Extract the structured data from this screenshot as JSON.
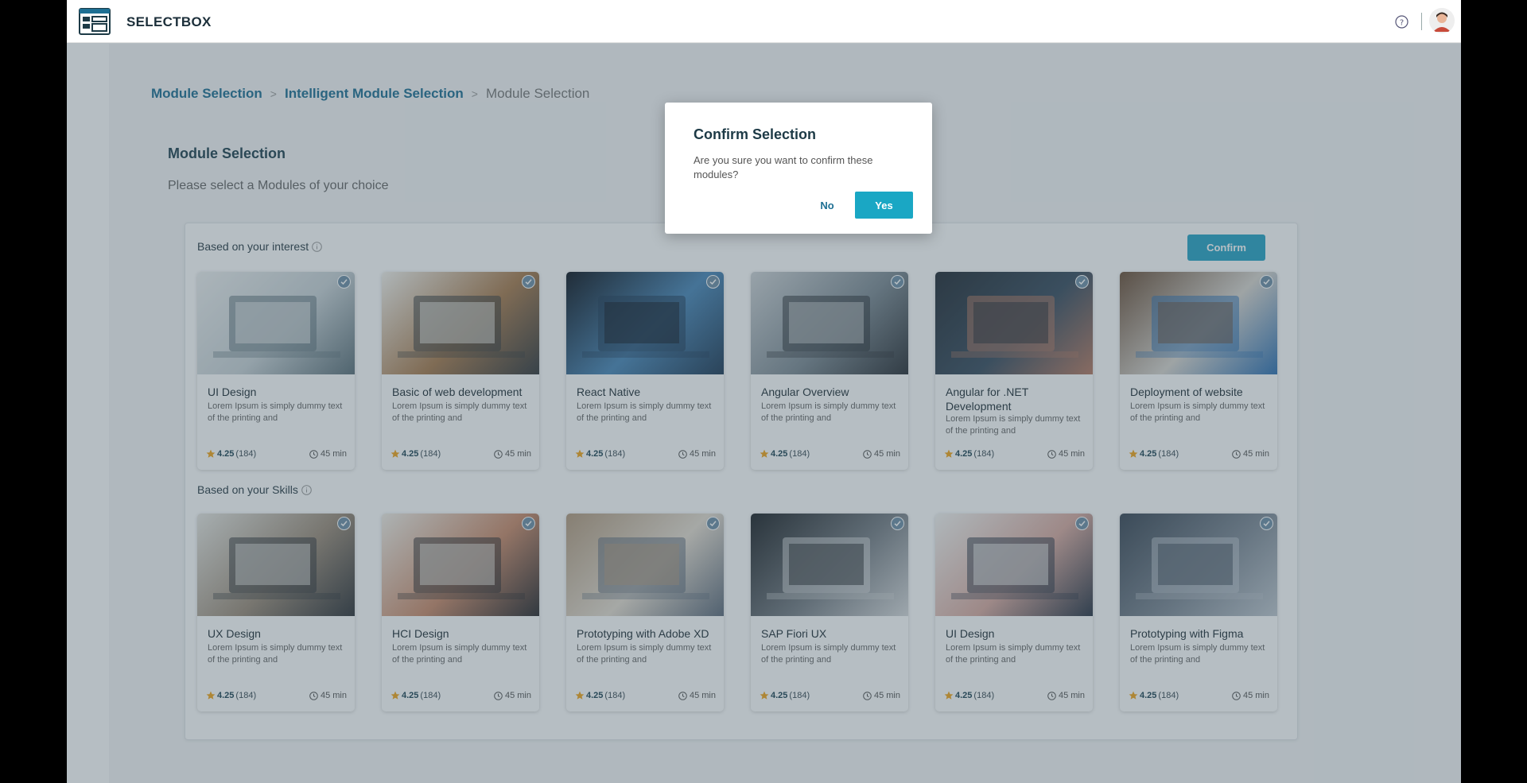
{
  "app": {
    "brand": "SELECTBOX"
  },
  "breadcrumb": [
    "Module Selection",
    "Intelligent Module Selection",
    "Module Selection"
  ],
  "page": {
    "title": "Module Selection",
    "subtitle": "Please select a Modules of your choice"
  },
  "sections": [
    {
      "title": "Based on your interest"
    },
    {
      "title": "Based on your Skills"
    }
  ],
  "confirm_label": "Confirm",
  "cards": [
    {
      "title": "UI Design",
      "desc": "Lorem Ipsum is simply dummy text of the printing and",
      "rating": "4.25",
      "count": "(184)",
      "duration": "45 min"
    },
    {
      "title": "Basic of web development",
      "desc": "Lorem Ipsum is simply dummy text of the printing and",
      "rating": "4.25",
      "count": "(184)",
      "duration": "45 min"
    },
    {
      "title": "React Native",
      "desc": "Lorem Ipsum is simply dummy text of the printing and",
      "rating": "4.25",
      "count": "(184)",
      "duration": "45 min"
    },
    {
      "title": "Angular Overview",
      "desc": "Lorem Ipsum is simply dummy text of the printing and",
      "rating": "4.25",
      "count": "(184)",
      "duration": "45 min"
    },
    {
      "title": "Angular for .NET Development",
      "desc": "Lorem Ipsum is simply dummy text of the printing and",
      "rating": "4.25",
      "count": "(184)",
      "duration": "45 min"
    },
    {
      "title": "Deployment of website",
      "desc": "Lorem Ipsum is simply dummy text of the printing and",
      "rating": "4.25",
      "count": "(184)",
      "duration": "45 min"
    },
    {
      "title": "UX Design",
      "desc": "Lorem Ipsum is simply dummy text of the printing and",
      "rating": "4.25",
      "count": "(184)",
      "duration": "45 min"
    },
    {
      "title": "HCI Design",
      "desc": "Lorem Ipsum is simply dummy text of the printing and",
      "rating": "4.25",
      "count": "(184)",
      "duration": "45 min"
    },
    {
      "title": "Prototyping with Adobe XD",
      "desc": "Lorem Ipsum is simply dummy text of the printing and",
      "rating": "4.25",
      "count": "(184)",
      "duration": "45 min"
    },
    {
      "title": "SAP Fiori UX",
      "desc": "Lorem Ipsum is simply dummy text of the printing and",
      "rating": "4.25",
      "count": "(184)",
      "duration": "45 min"
    },
    {
      "title": "UI Design",
      "desc": "Lorem Ipsum is simply dummy text of the printing and",
      "rating": "4.25",
      "count": "(184)",
      "duration": "45 min"
    },
    {
      "title": "Prototyping with Figma",
      "desc": "Lorem Ipsum is simply dummy text of the printing and",
      "rating": "4.25",
      "count": "(184)",
      "duration": "45 min"
    }
  ],
  "modal": {
    "title": "Confirm Selection",
    "message": "Are you sure you want to confirm these modules?",
    "no_label": "No",
    "yes_label": "Yes"
  },
  "colors": {
    "accent": "#1aa7c4",
    "link": "#1d6f93",
    "star": "#f2a51a"
  }
}
